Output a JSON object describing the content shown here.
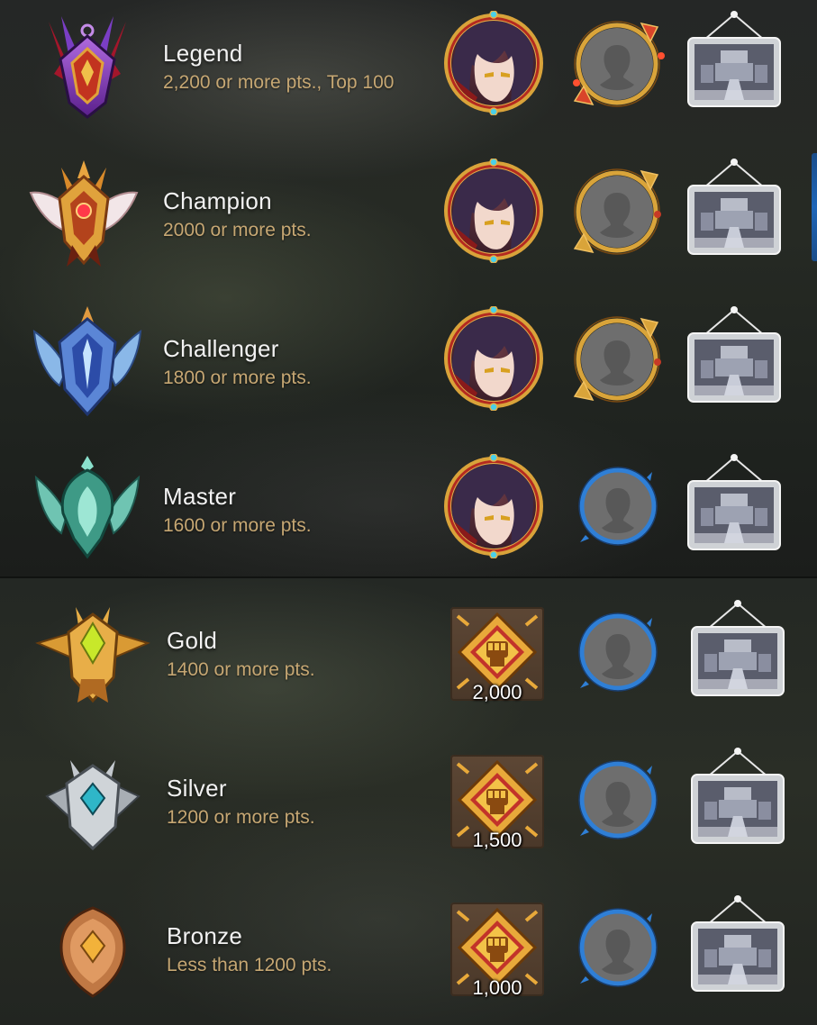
{
  "tiers": [
    {
      "name": "Legend",
      "requirement": "2,200 or more pts., Top 100",
      "emblem_icon": "legend-emblem-icon",
      "reward_type": "portrait",
      "frame_style": "red-gold"
    },
    {
      "name": "Champion",
      "requirement": "2000 or more pts.",
      "emblem_icon": "champion-emblem-icon",
      "reward_type": "portrait",
      "frame_style": "gold"
    },
    {
      "name": "Challenger",
      "requirement": "1800 or more pts.",
      "emblem_icon": "challenger-emblem-icon",
      "reward_type": "portrait",
      "frame_style": "gold"
    },
    {
      "name": "Master",
      "requirement": "1600 or more pts.",
      "emblem_icon": "master-emblem-icon",
      "reward_type": "portrait",
      "frame_style": "blue"
    },
    {
      "name": "Gold",
      "requirement": "1400 or more pts.",
      "emblem_icon": "gold-emblem-icon",
      "reward_type": "currency",
      "reward_amount": "2,000",
      "frame_style": "blue"
    },
    {
      "name": "Silver",
      "requirement": "1200 or more pts.",
      "emblem_icon": "silver-emblem-icon",
      "reward_type": "currency",
      "reward_amount": "1,500",
      "frame_style": "blue"
    },
    {
      "name": "Bronze",
      "requirement": "Less than 1200 pts.",
      "emblem_icon": "bronze-emblem-icon",
      "reward_type": "currency",
      "reward_amount": "1,000",
      "frame_style": "blue"
    }
  ],
  "colors": {
    "tier_name": "#f2f2f2",
    "requirement": "#c6a773",
    "blue_frame": "#2f7fd6",
    "gold_frame": "#d9a43a",
    "red_frame": "#b5281c"
  }
}
